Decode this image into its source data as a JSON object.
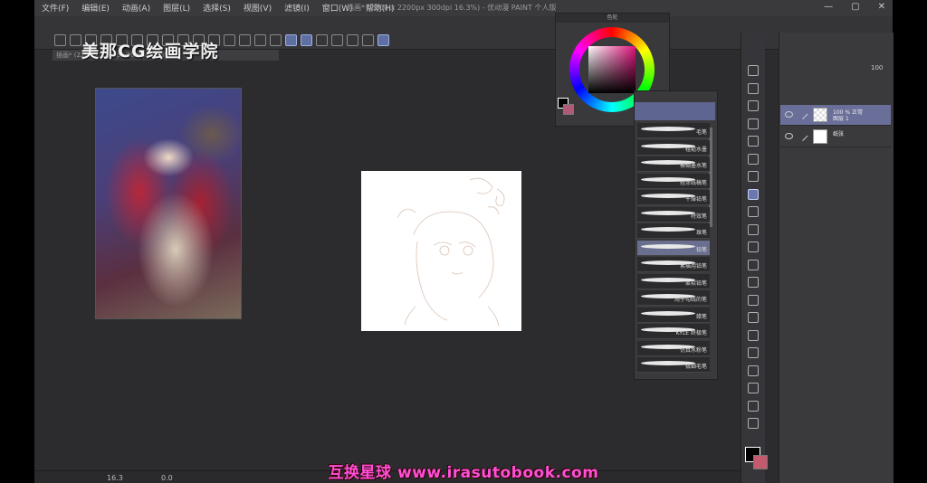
{
  "menu": [
    "文件(F)",
    "编辑(E)",
    "动画(A)",
    "图层(L)",
    "选择(S)",
    "视图(V)",
    "滤镜(I)",
    "窗口(W)",
    "帮助(H)"
  ],
  "window_title": "插画* (2200 x 2200px 300dpi 16.3%)  - 优动漫 PAINT 个人版",
  "window_buttons": {
    "minimize": "—",
    "maximize": "▢",
    "close": "✕"
  },
  "watermark_top": "美那CG绘画学院",
  "document_tab": "插画* (2200 x 2200px 300dpi 16.3%)",
  "color_panel": {
    "title": "色轮",
    "fg": "#000000",
    "bg": "#b05a78",
    "hue": "#e0137c"
  },
  "brush_panel": {
    "brushes": [
      {
        "label": "毛笔"
      },
      {
        "label": "粗糙水墨"
      },
      {
        "label": "模糊墨水笔"
      },
      {
        "label": "轻涂线稿笔"
      },
      {
        "label": "干燥铅笔"
      },
      {
        "label": "特效笔"
      },
      {
        "label": "珠笔"
      },
      {
        "label": "铅笔",
        "selected": true
      },
      {
        "label": "素描用铅笔"
      },
      {
        "label": "柔软铅笔"
      },
      {
        "label": "用于勾线的笔"
      },
      {
        "label": "蜡笔"
      },
      {
        "label": "KYLE 终极笔"
      },
      {
        "label": "仿真水粉笔"
      },
      {
        "label": "极细毛笔"
      }
    ]
  },
  "layer_panel": {
    "opacity": "100",
    "layers": [
      {
        "name": "100 % 正常\n图层 1",
        "selected": true
      },
      {
        "name": "纸张",
        "selected": false
      }
    ]
  },
  "status": {
    "zoom": "16.3",
    "angle": "0.0"
  },
  "footer_watermark": "互换星球 www.irasutobook.com"
}
